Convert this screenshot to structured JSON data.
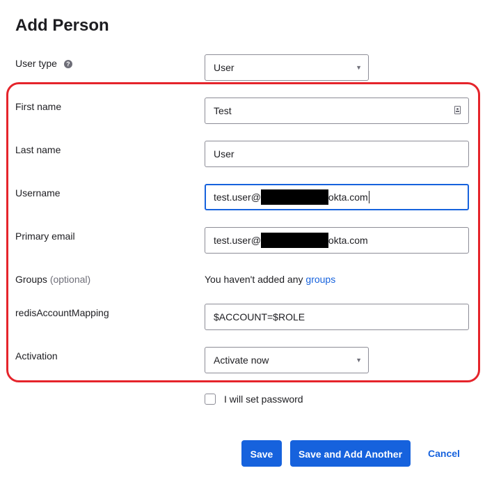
{
  "page": {
    "title": "Add Person"
  },
  "form": {
    "user_type": {
      "label": "User type",
      "help_icon": "?",
      "value": "User",
      "icon": "chevron-down-icon"
    },
    "first_name": {
      "label": "First name",
      "value": "Test",
      "icon": "contact-card-icon"
    },
    "last_name": {
      "label": "Last name",
      "value": "User"
    },
    "username": {
      "label": "Username",
      "value_prefix": "test.user@",
      "value_suffix": "okta.com",
      "redacted": true
    },
    "primary_email": {
      "label": "Primary email",
      "value_prefix": "test.user@",
      "value_suffix": "okta.com",
      "redacted": true
    },
    "groups": {
      "label": "Groups",
      "label_optional": "(optional)",
      "text": "You haven't added any",
      "link": "groups"
    },
    "redis_mapping": {
      "label": "redisAccountMapping",
      "value": "$ACCOUNT=$ROLE"
    },
    "activation": {
      "label": "Activation",
      "value": "Activate now"
    },
    "set_password": {
      "label": "I will set password",
      "checked": false
    }
  },
  "actions": {
    "save": "Save",
    "save_add_another": "Save and Add Another",
    "cancel": "Cancel"
  },
  "colors": {
    "accent": "#1662dd",
    "highlight": "#e5242b",
    "text": "#1d1d21",
    "muted": "#6e6e78"
  }
}
